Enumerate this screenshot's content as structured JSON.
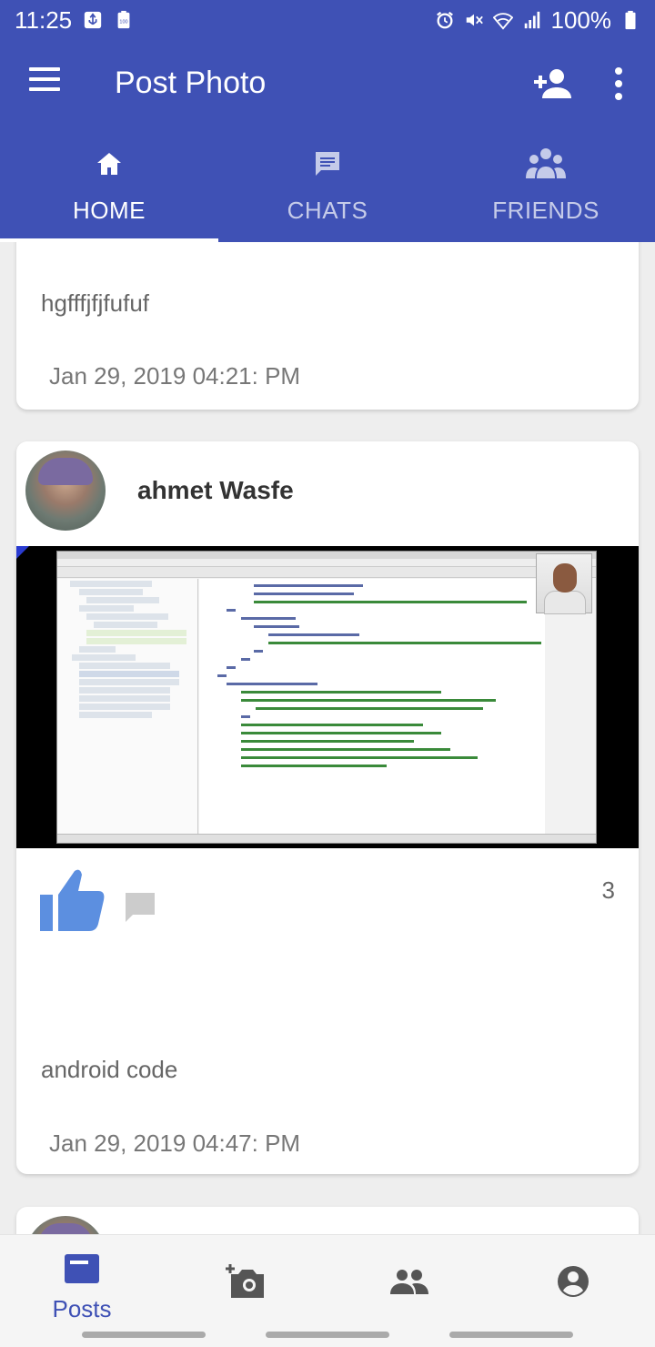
{
  "status_bar": {
    "time": "11:25",
    "battery": "100%",
    "icons": [
      "usb-icon",
      "battery-saver-icon",
      "alarm-icon",
      "mute-icon",
      "wifi-icon",
      "signal-icon",
      "battery-icon"
    ]
  },
  "app_bar": {
    "title": "Post Photo",
    "icons": [
      "menu-icon",
      "add-person-icon",
      "more-vert-icon"
    ]
  },
  "tabs": [
    {
      "label": "HOME",
      "icon": "home-icon",
      "active": true
    },
    {
      "label": "CHATS",
      "icon": "chat-icon",
      "active": false
    },
    {
      "label": "FRIENDS",
      "icon": "group-icon",
      "active": false
    }
  ],
  "posts": [
    {
      "text": "hgfffjfjfufuf",
      "date": "Jan 29, 2019 04:21: PM"
    },
    {
      "username": "ahmet Wasfe",
      "likes": "3",
      "text": "android code",
      "date": "Jan 29, 2019 04:47: PM"
    }
  ],
  "bottom_nav": [
    {
      "label": "Posts",
      "icon": "posts-icon",
      "active": true
    },
    {
      "label": "",
      "icon": "add-photo-icon",
      "active": false
    },
    {
      "label": "",
      "icon": "people-icon",
      "active": false
    },
    {
      "label": "",
      "icon": "account-icon",
      "active": false
    }
  ],
  "colors": {
    "primary": "#3f51b5",
    "like_blue": "#5c8fe0",
    "background": "#eeeeee"
  }
}
